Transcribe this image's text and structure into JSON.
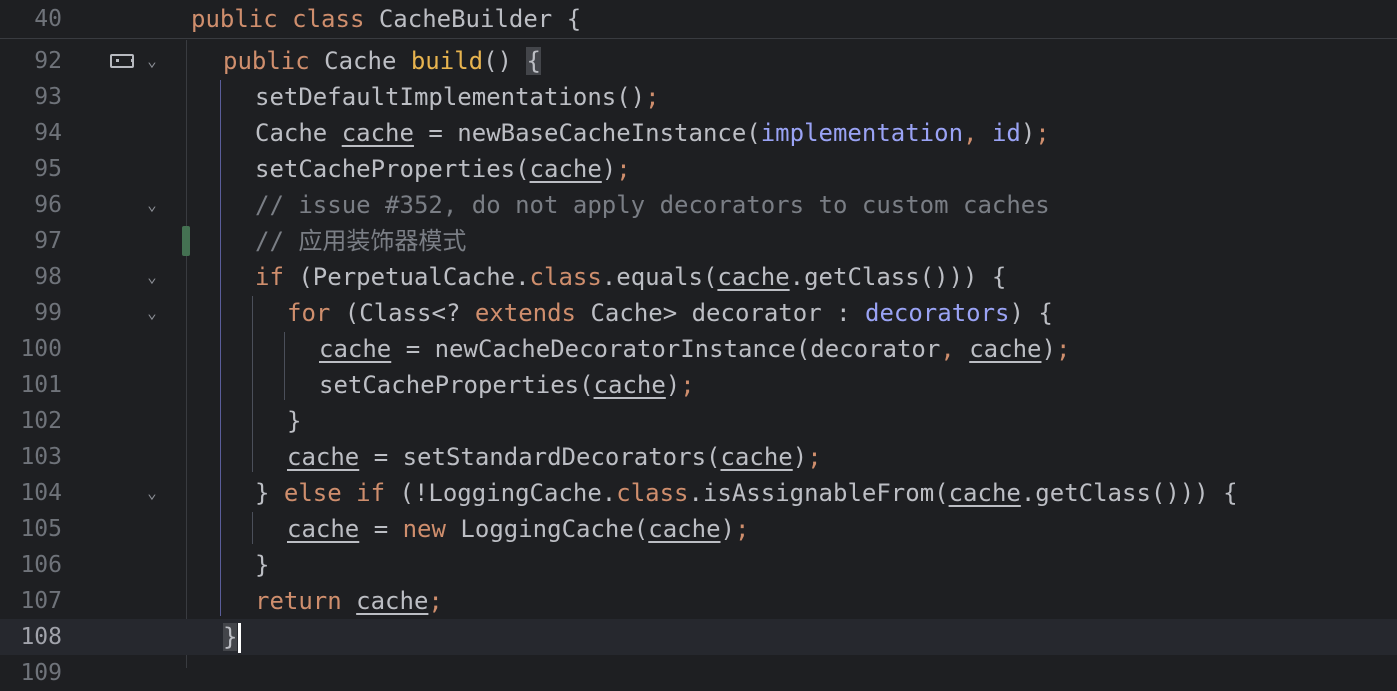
{
  "sticky": {
    "line_number": "40",
    "code": "public class CacheBuilder {"
  },
  "lines": [
    {
      "n": "92"
    },
    {
      "n": "93"
    },
    {
      "n": "94"
    },
    {
      "n": "95"
    },
    {
      "n": "96"
    },
    {
      "n": "97"
    },
    {
      "n": "98"
    },
    {
      "n": "99"
    },
    {
      "n": "100"
    },
    {
      "n": "101"
    },
    {
      "n": "102"
    },
    {
      "n": "103"
    },
    {
      "n": "104"
    },
    {
      "n": "105"
    },
    {
      "n": "106"
    },
    {
      "n": "107"
    },
    {
      "n": "108"
    },
    {
      "n": "109"
    }
  ],
  "code": {
    "l92": {
      "kw1": "public",
      "type": "Cache",
      "method": "build",
      "rest": "() ",
      "brace": "{"
    },
    "l93": {
      "call": "setDefaultImplementations()",
      "semi": ";"
    },
    "l94": {
      "type": "Cache",
      "var": "cache",
      "eq": " = newBaseCacheInstance(",
      "f1": "implementation",
      "comma": ", ",
      "f2": "id",
      "close": ")",
      "semi": ";"
    },
    "l95": {
      "call": "setCacheProperties(",
      "var": "cache",
      "close": ")",
      "semi": ";"
    },
    "l96": {
      "comment": "// issue #352, do not apply decorators to custom caches"
    },
    "l97": {
      "comment": "// 应用装饰器模式"
    },
    "l98": {
      "kw": "if",
      "a": " (PerpetualCache.",
      "kw2": "class",
      "b": ".equals(",
      "var": "cache",
      "c": ".getClass())) {"
    },
    "l99": {
      "kw": "for",
      "a": " (Class<? ",
      "kw2": "extends",
      "b": " Cache> decorator : ",
      "field": "decorators",
      "c": ") {"
    },
    "l100": {
      "var": "cache",
      "a": " = newCacheDecoratorInstance(decorator",
      "comma": ", ",
      "var2": "cache",
      "close": ")",
      "semi": ";"
    },
    "l101": {
      "a": "setCacheProperties(",
      "var": "cache",
      "close": ")",
      "semi": ";"
    },
    "l102": {
      "a": "}"
    },
    "l103": {
      "var": "cache",
      "a": " = setStandardDecorators(",
      "var2": "cache",
      "close": ")",
      "semi": ";"
    },
    "l104": {
      "a": "} ",
      "kw": "else if",
      "b": " (!LoggingCache.",
      "kw2": "class",
      "c": ".isAssignableFrom(",
      "var": "cache",
      "d": ".getClass())) {"
    },
    "l105": {
      "var": "cache",
      "a": " = ",
      "kw": "new",
      "b": " LoggingCache(",
      "var2": "cache",
      "close": ")",
      "semi": ";"
    },
    "l106": {
      "a": "}"
    },
    "l107": {
      "kw": "return",
      "sp": " ",
      "var": "cache",
      "semi": ";"
    },
    "l108": {
      "a": "}"
    }
  },
  "colors": {
    "background": "#1e1f22",
    "keyword": "#cf8e6d",
    "comment": "#7a7e85",
    "field": "#9aa3f5",
    "method_decl": "#e8b44f",
    "vcs_added": "#447152"
  },
  "icons": [
    "implementation-gutter-icon",
    "fold-chevron-icon"
  ]
}
